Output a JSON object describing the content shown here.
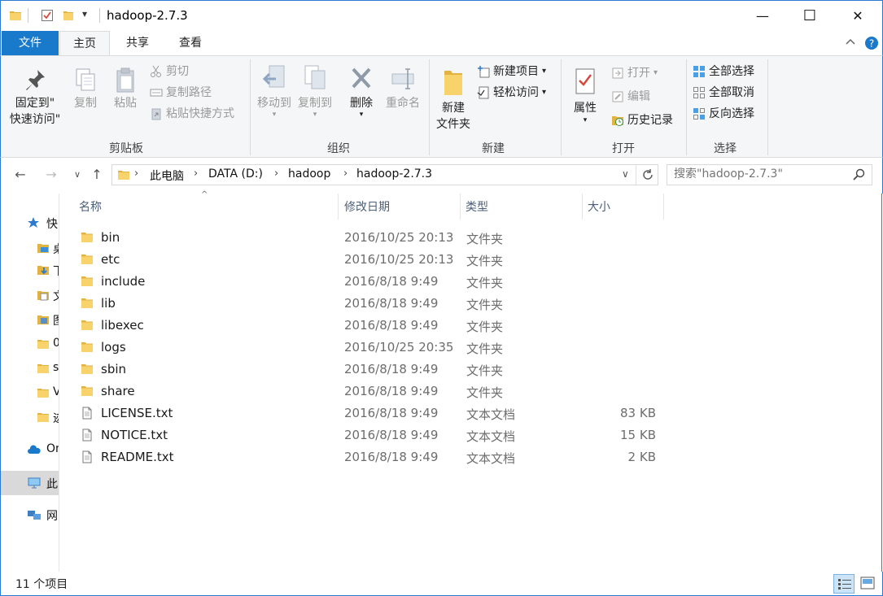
{
  "window": {
    "title": "hadoop-2.7.3",
    "minimize_glyph": "—",
    "maximize_glyph": "☐",
    "close_glyph": "✕",
    "qat_dropdown_glyph": "▾"
  },
  "tabs": [
    {
      "label": "文件"
    },
    {
      "label": "主页"
    },
    {
      "label": "共享"
    },
    {
      "label": "查看"
    }
  ],
  "ribbon": {
    "clipboard": {
      "pin_label_1": "固定到\"",
      "pin_label_2": "快速访问\"",
      "copy_label": "复制",
      "paste_label": "粘贴",
      "cut_label": "剪切",
      "copy_path_label": "复制路径",
      "paste_shortcut_label": "粘贴快捷方式",
      "group_label": "剪贴板"
    },
    "organize": {
      "move_to_label": "移动到",
      "copy_to_label": "复制到",
      "delete_label": "删除",
      "rename_label": "重命名",
      "group_label": "组织"
    },
    "new": {
      "new_folder_label_1": "新建",
      "new_folder_label_2": "文件夹",
      "new_item_label": "新建项目",
      "easy_access_label": "轻松访问",
      "group_label": "新建"
    },
    "open": {
      "properties_label": "属性",
      "open_label": "打开",
      "edit_label": "编辑",
      "history_label": "历史记录",
      "group_label": "打开"
    },
    "select": {
      "select_all_label": "全部选择",
      "select_none_label": "全部取消",
      "invert_label": "反向选择",
      "group_label": "选择"
    }
  },
  "address": {
    "crumbs": [
      "此电脑",
      "DATA (D:)",
      "hadoop",
      "hadoop-2.7.3"
    ],
    "search_placeholder": "搜索\"hadoop-2.7.3\""
  },
  "navpane": {
    "items": [
      {
        "label": "快"
      },
      {
        "label": "桌"
      },
      {
        "label": "下"
      },
      {
        "label": "文"
      },
      {
        "label": "图"
      },
      {
        "label": "0"
      },
      {
        "label": "s"
      },
      {
        "label": "V"
      },
      {
        "label": "迹"
      },
      {
        "label": "On"
      },
      {
        "label": "此"
      },
      {
        "label": "网"
      }
    ]
  },
  "columns": {
    "name": "名称",
    "date": "修改日期",
    "type": "类型",
    "size": "大小"
  },
  "files": [
    {
      "name": "bin",
      "date": "2016/10/25 20:13",
      "type": "文件夹",
      "size": "",
      "kind": "folder"
    },
    {
      "name": "etc",
      "date": "2016/10/25 20:13",
      "type": "文件夹",
      "size": "",
      "kind": "folder"
    },
    {
      "name": "include",
      "date": "2016/8/18 9:49",
      "type": "文件夹",
      "size": "",
      "kind": "folder"
    },
    {
      "name": "lib",
      "date": "2016/8/18 9:49",
      "type": "文件夹",
      "size": "",
      "kind": "folder"
    },
    {
      "name": "libexec",
      "date": "2016/8/18 9:49",
      "type": "文件夹",
      "size": "",
      "kind": "folder"
    },
    {
      "name": "logs",
      "date": "2016/10/25 20:35",
      "type": "文件夹",
      "size": "",
      "kind": "folder"
    },
    {
      "name": "sbin",
      "date": "2016/8/18 9:49",
      "type": "文件夹",
      "size": "",
      "kind": "folder"
    },
    {
      "name": "share",
      "date": "2016/8/18 9:49",
      "type": "文件夹",
      "size": "",
      "kind": "folder"
    },
    {
      "name": "LICENSE.txt",
      "date": "2016/8/18 9:49",
      "type": "文本文档",
      "size": "83 KB",
      "kind": "text"
    },
    {
      "name": "NOTICE.txt",
      "date": "2016/8/18 9:49",
      "type": "文本文档",
      "size": "15 KB",
      "kind": "text"
    },
    {
      "name": "README.txt",
      "date": "2016/8/18 9:49",
      "type": "文本文档",
      "size": "2 KB",
      "kind": "text"
    }
  ],
  "status": {
    "item_count": "11 个项目"
  },
  "colors": {
    "accent": "#1979ca",
    "folder": "#f8d26a",
    "folder_dark": "#e3b341",
    "border": "#2b79d0"
  }
}
